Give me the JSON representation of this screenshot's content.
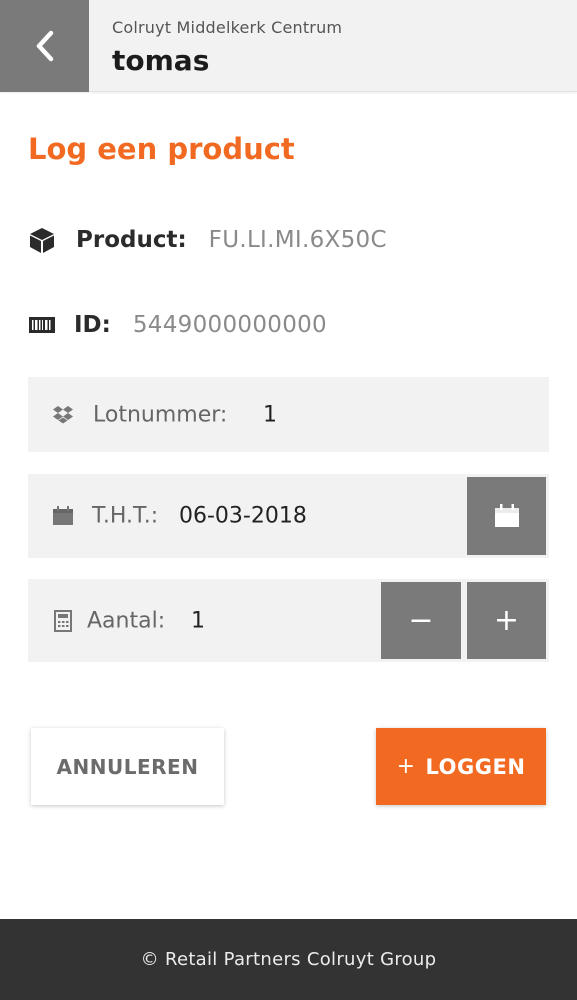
{
  "header": {
    "store_name": "Colruyt Middelkerk Centrum",
    "user_name": "tomas",
    "back_icon": "chevron-left-icon"
  },
  "page": {
    "title": "Log een product"
  },
  "product": {
    "icon": "cube-icon",
    "label": "Product:",
    "value": "FU.LI.MI.6X50C"
  },
  "id": {
    "icon": "barcode-icon",
    "label": "ID:",
    "value": "5449000000000"
  },
  "lot": {
    "icon": "dropbox-icon",
    "label": "Lotnummer:",
    "value": "1"
  },
  "tht": {
    "icon": "calendar-icon",
    "label": "T.H.T.:",
    "value": "06-03-2018"
  },
  "quantity": {
    "icon": "calculator-icon",
    "label": "Aantal:",
    "value": "1",
    "minus": "−",
    "plus": "+"
  },
  "actions": {
    "cancel_label": "ANNULEREN",
    "log_plus": "+",
    "log_label": "LOGGEN"
  },
  "footer": {
    "text": "© Retail Partners Colruyt Group"
  },
  "colors": {
    "accent": "#f26a21",
    "button_gray": "#7a7a7a",
    "field_bg": "#f3f2f3",
    "footer_bg": "#333333"
  }
}
